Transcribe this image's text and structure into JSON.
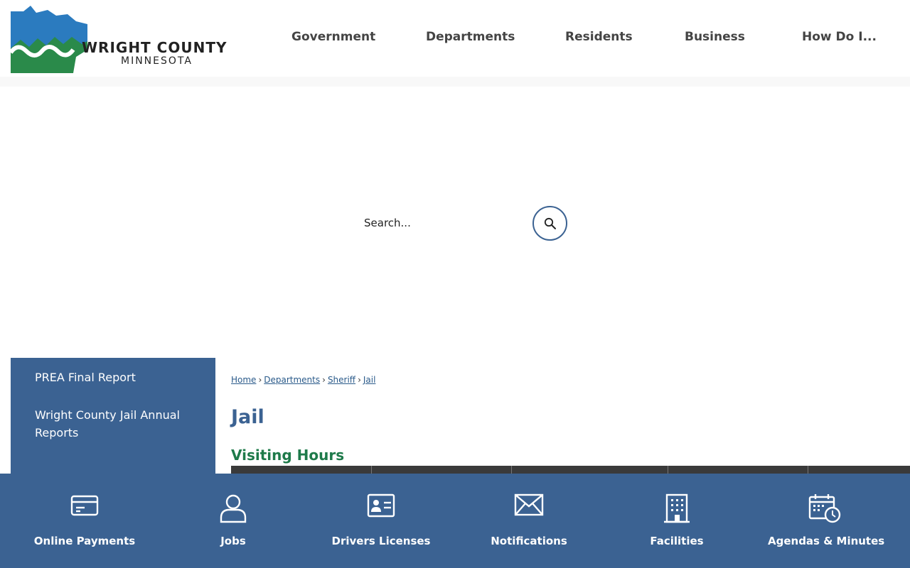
{
  "header": {
    "logo": {
      "name": "WRIGHT COUNTY",
      "state": "MINNESOTA"
    },
    "nav": [
      "Government",
      "Departments",
      "Residents",
      "Business",
      "How Do I..."
    ]
  },
  "search": {
    "placeholder": "Search..."
  },
  "sidebar": {
    "items": [
      "PREA Final Report",
      "Wright County Jail Annual Reports"
    ]
  },
  "breadcrumb": {
    "items": [
      "Home",
      "Departments",
      "Sheriff",
      "Jail"
    ],
    "separator": "›"
  },
  "main": {
    "title": "Jail",
    "section_heading": "Visiting Hours"
  },
  "quick_links": [
    {
      "label": "Online Payments",
      "icon": "credit-card-icon"
    },
    {
      "label": "Jobs",
      "icon": "person-icon"
    },
    {
      "label": "Drivers Licenses",
      "icon": "id-card-icon"
    },
    {
      "label": "Notifications",
      "icon": "envelope-icon"
    },
    {
      "label": "Facilities",
      "icon": "building-icon"
    },
    {
      "label": "Agendas & Minutes",
      "icon": "calendar-clock-icon"
    }
  ],
  "colors": {
    "brand_blue": "#3b6292",
    "heading_green": "#1e7a4a",
    "logo_blue": "#2b7bbf",
    "logo_green": "#2a8a4a"
  }
}
